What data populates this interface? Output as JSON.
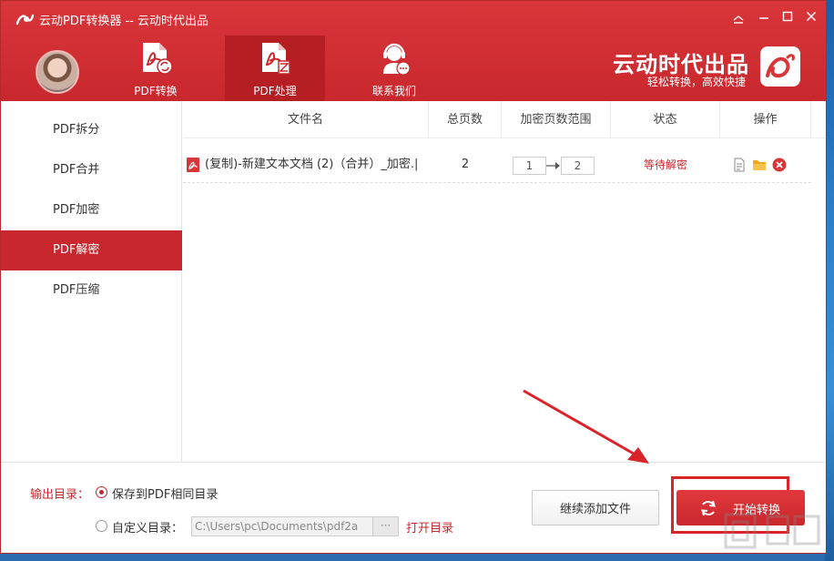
{
  "window": {
    "title": "云动PDF转换器 -- 云动时代出品",
    "controls": [
      "gift-icon",
      "minimize-icon",
      "maximize-icon",
      "close-icon"
    ]
  },
  "header": {
    "tabs": [
      {
        "label": "PDF转换",
        "icon": "pdf-convert-icon",
        "active": false
      },
      {
        "label": "PDF处理",
        "icon": "pdf-process-icon",
        "active": true
      },
      {
        "label": "联系我们",
        "icon": "support-agent-icon",
        "active": false
      }
    ],
    "brand": "云动时代出品",
    "slogan": "轻松转换，高效快捷"
  },
  "sidebar": {
    "items": [
      {
        "label": "PDF拆分",
        "active": false
      },
      {
        "label": "PDF合并",
        "active": false
      },
      {
        "label": "PDF加密",
        "active": false
      },
      {
        "label": "PDF解密",
        "active": true
      },
      {
        "label": "PDF压缩",
        "active": false
      }
    ]
  },
  "table": {
    "columns": [
      "文件名",
      "总页数",
      "加密页数范围",
      "状态",
      "操作"
    ],
    "rows": [
      {
        "filename": "(复制)-新建文本文档 (2)（合并）_加密.|",
        "pages": "2",
        "range_from": "1",
        "range_to": "2",
        "status": "等待解密"
      }
    ]
  },
  "footer": {
    "output_label": "输出目录：",
    "option_same": "保存到PDF相同目录",
    "option_custom": "自定义目录：",
    "custom_path": "C:\\Users\\pc\\Documents\\pdf2a",
    "browse": "···",
    "open_dir": "打开目录",
    "add_button": "继续添加文件",
    "start_button": "开始转换"
  },
  "colors": {
    "brand_red": "#c8282d",
    "active_red": "#b51e22",
    "status_red": "#c8282d"
  }
}
